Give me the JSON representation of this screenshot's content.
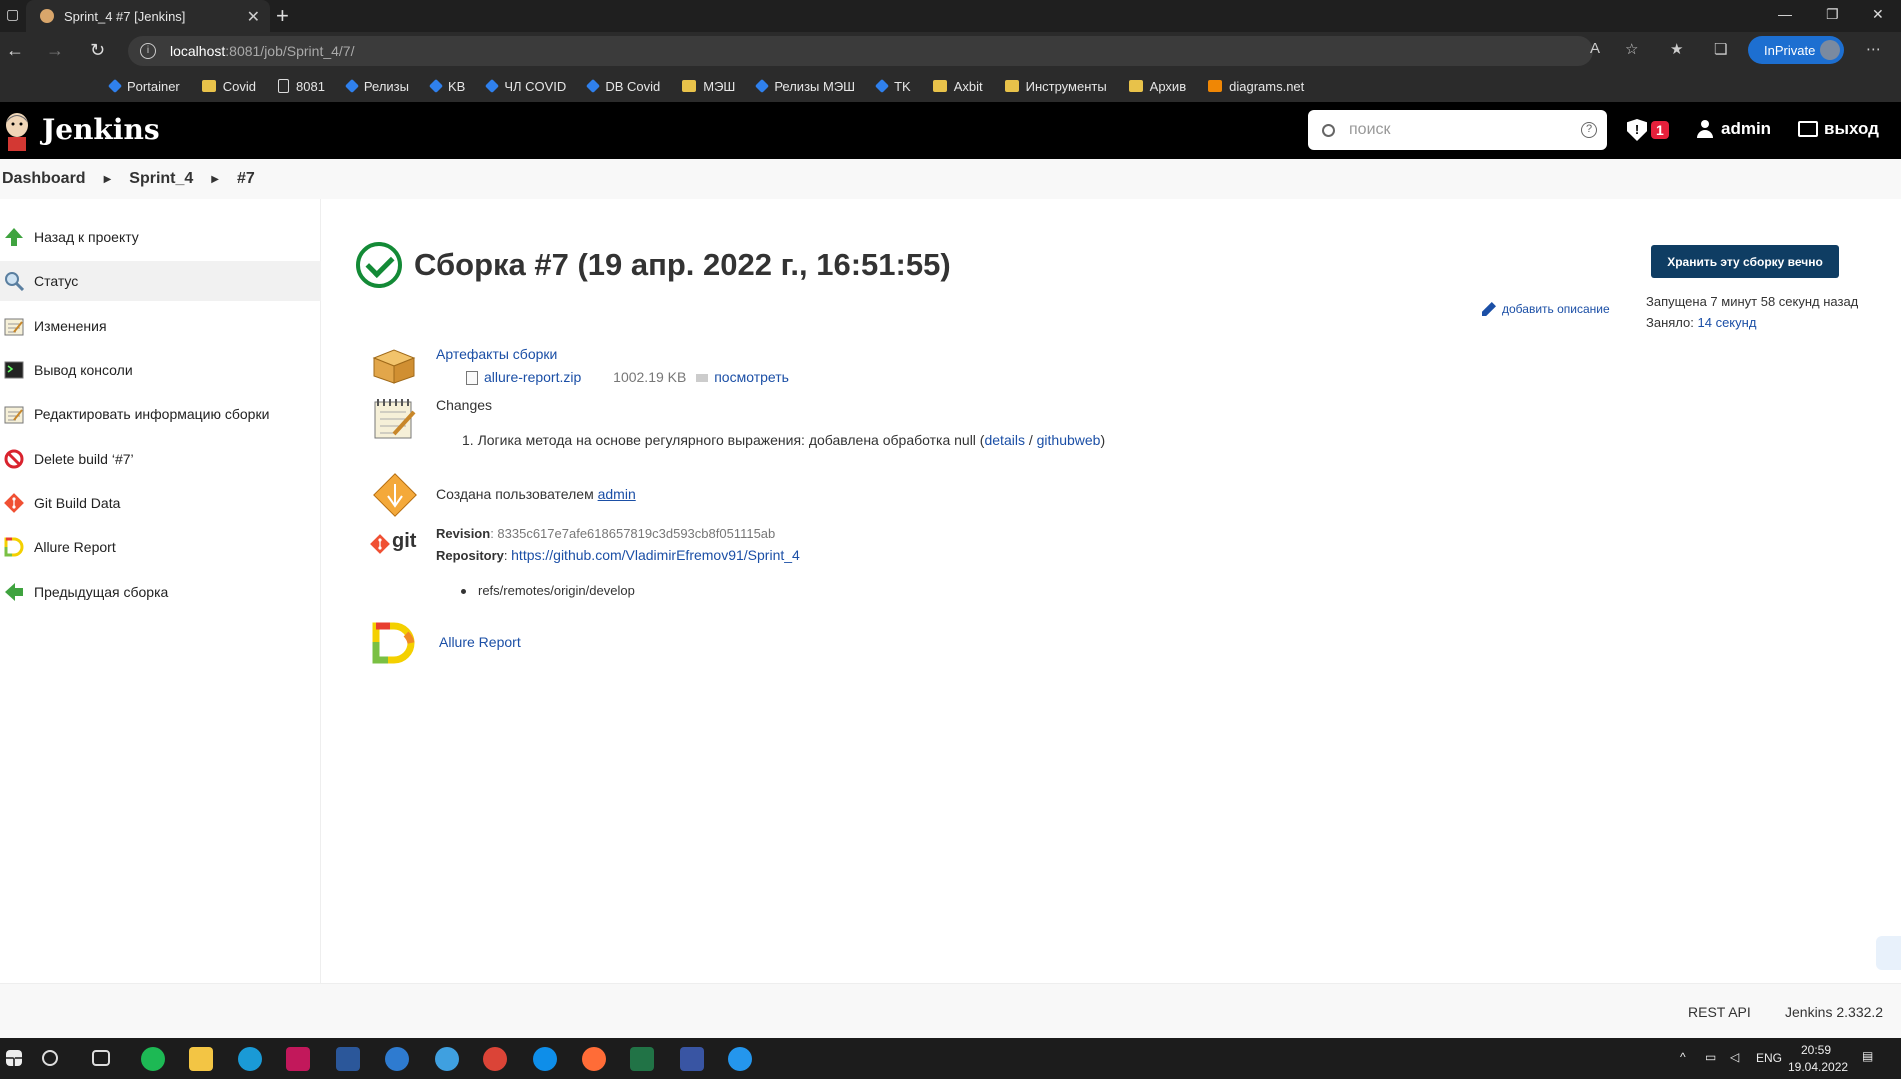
{
  "browser": {
    "tab_title": "Sprint_4 #7 [Jenkins]",
    "url_host": "localhost",
    "url_path": ":8081/job/Sprint_4/7/",
    "inprivate_label": "InPrivate",
    "bookmarks": [
      {
        "label": "Portainer",
        "icon": "diamond-icon"
      },
      {
        "label": "Covid",
        "icon": "folder-icon"
      },
      {
        "label": "8081",
        "icon": "page-icon"
      },
      {
        "label": "Релизы",
        "icon": "diamond-icon"
      },
      {
        "label": "KB",
        "icon": "diamond-icon"
      },
      {
        "label": "ЧЛ COVID",
        "icon": "diamond-icon"
      },
      {
        "label": "DB Covid",
        "icon": "diamond-icon"
      },
      {
        "label": "МЭШ",
        "icon": "folder-icon"
      },
      {
        "label": "Релизы МЭШ",
        "icon": "diamond-icon"
      },
      {
        "label": "TK",
        "icon": "diamond-icon"
      },
      {
        "label": "Axbit",
        "icon": "folder-icon"
      },
      {
        "label": "Инструменты",
        "icon": "folder-icon"
      },
      {
        "label": "Архив",
        "icon": "folder-icon"
      },
      {
        "label": "diagrams.net",
        "icon": "diagrams-icon"
      }
    ]
  },
  "header": {
    "app_name": "Jenkins",
    "search_placeholder": "поиск",
    "alert_count": "1",
    "user": "admin",
    "logout": "выход"
  },
  "breadcrumbs": [
    "Dashboard",
    "Sprint_4",
    "#7"
  ],
  "sidebar": {
    "items": [
      {
        "label": "Назад к проекту",
        "icon": "up-arrow-icon"
      },
      {
        "label": "Статус",
        "icon": "magnifier-icon"
      },
      {
        "label": "Изменения",
        "icon": "notepad-icon"
      },
      {
        "label": "Вывод консоли",
        "icon": "terminal-icon"
      },
      {
        "label": "Редактировать информацию сборки",
        "icon": "notepad-icon"
      },
      {
        "label": "Delete build ‘#7’",
        "icon": "no-entry-icon"
      },
      {
        "label": "Git Build Data",
        "icon": "git-icon"
      },
      {
        "label": "Allure Report",
        "icon": "allure-icon"
      },
      {
        "label": "Предыдущая сборка",
        "icon": "left-arrow-icon"
      }
    ]
  },
  "build": {
    "title": "Сборка #7 (19 апр. 2022 г., 16:51:55)",
    "keep_button": "Хранить эту сборку вечно",
    "started": "Запущена 7 минут 58 секунд назад",
    "took_label": "Заняло:",
    "took_value": "14 секунд",
    "add_description": "добавить описание",
    "artifacts_label": "Артефакты сборки",
    "artifact_file": "allure-report.zip",
    "artifact_size": "1002.19 KB",
    "artifact_view": "посмотреть",
    "changes_label": "Changes",
    "change_index": "1.",
    "change_text": "Логика метода на основе регулярного выражения: добавлена обработка null (",
    "change_details": "details",
    "change_sep": " / ",
    "change_githubweb": "githubweb",
    "change_close": ")",
    "created_by_label": "Создана пользователем",
    "created_by_user": "admin",
    "revision_label": "Revision",
    "revision_value": ": 8335c617e7afe618657819c3d593cb8f051115ab",
    "repository_label": "Repository",
    "repository_colon": ": ",
    "repository_url": "https://github.com/VladimirEfremov91/Sprint_4",
    "branch": "refs/remotes/origin/develop",
    "allure_link": "Allure Report",
    "git_logo_text": "git"
  },
  "footer": {
    "rest_api": "REST API",
    "version": "Jenkins 2.332.2"
  },
  "taskbar": {
    "lang": "ENG",
    "time": "20:59",
    "date": "19.04.2022"
  },
  "colors": {
    "success": "#138a36",
    "link": "#1b4fa6",
    "keep_button": "#0f3d63",
    "alert_badge": "#e6203b"
  }
}
